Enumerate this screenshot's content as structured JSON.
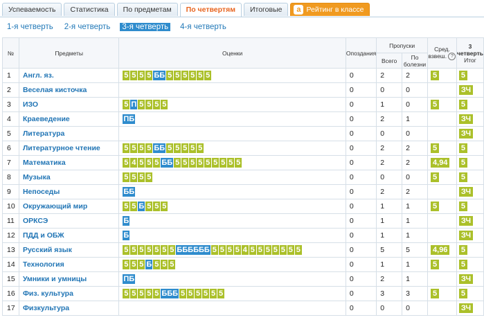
{
  "tabs": [
    {
      "label": "Успеваемость",
      "active": false
    },
    {
      "label": "Статистика",
      "active": false
    },
    {
      "label": "По предметам",
      "active": false
    },
    {
      "label": "По четвертям",
      "active": true
    },
    {
      "label": "Итоговые",
      "active": false
    }
  ],
  "rating_tab": {
    "logo": "a",
    "label": "Рейтинг в классе"
  },
  "quarters": [
    {
      "label": "1-я четверть",
      "active": false
    },
    {
      "label": "2-я четверть",
      "active": false
    },
    {
      "label": "3-я четверть",
      "active": true
    },
    {
      "label": "4-я четверть",
      "active": false
    }
  ],
  "headers": {
    "num": "№",
    "subject": "Предметы",
    "grades": "Оценки",
    "late": "Опоздания",
    "absences": "Пропуски",
    "total": "Всего",
    "sick": "По болезни",
    "avg": "Сред. взвеш.",
    "avg_icon": "?",
    "final_bold": "3 четверть",
    "final": "Итог"
  },
  "rows": [
    {
      "num": "1",
      "subject": "Англ. яз.",
      "grades": [
        "5",
        "5",
        "5",
        "5",
        "ББ",
        "5",
        "5",
        "5",
        "5",
        "5",
        "5"
      ],
      "late": "0",
      "total": "2",
      "sick": "2",
      "avg": "5",
      "final": "5"
    },
    {
      "num": "2",
      "subject": "Веселая кисточка",
      "grades": [],
      "late": "0",
      "total": "0",
      "sick": "0",
      "avg": "",
      "final": "ЗЧ"
    },
    {
      "num": "3",
      "subject": "ИЗО",
      "grades": [
        "5",
        "П",
        "5",
        "5",
        "5",
        "5"
      ],
      "late": "0",
      "total": "1",
      "sick": "0",
      "avg": "5",
      "final": "5"
    },
    {
      "num": "4",
      "subject": "Краеведение",
      "grades": [
        "ПБ"
      ],
      "late": "0",
      "total": "2",
      "sick": "1",
      "avg": "",
      "final": "ЗЧ"
    },
    {
      "num": "5",
      "subject": "Литература",
      "grades": [],
      "late": "0",
      "total": "0",
      "sick": "0",
      "avg": "",
      "final": "ЗЧ"
    },
    {
      "num": "6",
      "subject": "Литературное чтение",
      "grades": [
        "5",
        "5",
        "5",
        "5",
        "ББ",
        "5",
        "5",
        "5",
        "5",
        "5"
      ],
      "late": "0",
      "total": "2",
      "sick": "2",
      "avg": "5",
      "final": "5"
    },
    {
      "num": "7",
      "subject": "Математика",
      "grades": [
        "5",
        "4",
        "5",
        "5",
        "5",
        "ББ",
        "5",
        "5",
        "5",
        "5",
        "5",
        "5",
        "5",
        "5",
        "5"
      ],
      "late": "0",
      "total": "2",
      "sick": "2",
      "avg": "4,94",
      "final": "5"
    },
    {
      "num": "8",
      "subject": "Музыка",
      "grades": [
        "5",
        "5",
        "5",
        "5"
      ],
      "late": "0",
      "total": "0",
      "sick": "0",
      "avg": "5",
      "final": "5"
    },
    {
      "num": "9",
      "subject": "Непоседы",
      "grades": [
        "ББ"
      ],
      "late": "0",
      "total": "2",
      "sick": "2",
      "avg": "",
      "final": "ЗЧ"
    },
    {
      "num": "10",
      "subject": "Окружающий мир",
      "grades": [
        "5",
        "5",
        "Б",
        "5",
        "5",
        "5"
      ],
      "late": "0",
      "total": "1",
      "sick": "1",
      "avg": "5",
      "final": "5"
    },
    {
      "num": "11",
      "subject": "ОРКСЭ",
      "grades": [
        "Б"
      ],
      "late": "0",
      "total": "1",
      "sick": "1",
      "avg": "",
      "final": "ЗЧ"
    },
    {
      "num": "12",
      "subject": "ПДД и ОБЖ",
      "grades": [
        "Б"
      ],
      "late": "0",
      "total": "1",
      "sick": "1",
      "avg": "",
      "final": "ЗЧ"
    },
    {
      "num": "13",
      "subject": "Русский язык",
      "grades": [
        "5",
        "5",
        "5",
        "5",
        "5",
        "5",
        "5",
        "ББББББ",
        "5",
        "5",
        "5",
        "5",
        "4",
        "5",
        "5",
        "5",
        "5",
        "5",
        "5",
        "5"
      ],
      "late": "0",
      "total": "5",
      "sick": "5",
      "avg": "4,96",
      "final": "5"
    },
    {
      "num": "14",
      "subject": "Технология",
      "grades": [
        "5",
        "5",
        "5",
        "Б",
        "5",
        "5",
        "5"
      ],
      "late": "0",
      "total": "1",
      "sick": "1",
      "avg": "5",
      "final": "5"
    },
    {
      "num": "15",
      "subject": "Умники и умницы",
      "grades": [
        "ПБ"
      ],
      "late": "0",
      "total": "2",
      "sick": "1",
      "avg": "",
      "final": "ЗЧ"
    },
    {
      "num": "16",
      "subject": "Физ. культура",
      "grades": [
        "5",
        "5",
        "5",
        "5",
        "5",
        "БББ",
        "5",
        "5",
        "5",
        "5",
        "5",
        "5"
      ],
      "late": "0",
      "total": "3",
      "sick": "3",
      "avg": "5",
      "final": "5"
    },
    {
      "num": "17",
      "subject": "Физкультура",
      "grades": [],
      "late": "0",
      "total": "0",
      "sick": "0",
      "avg": "",
      "final": "ЗЧ"
    }
  ],
  "colors": {
    "grade_green": "#abc02a",
    "grade_blue": "#2f8ccd",
    "link": "#2175b5",
    "active_tab": "#e7641f",
    "rating": "#f09a20"
  }
}
